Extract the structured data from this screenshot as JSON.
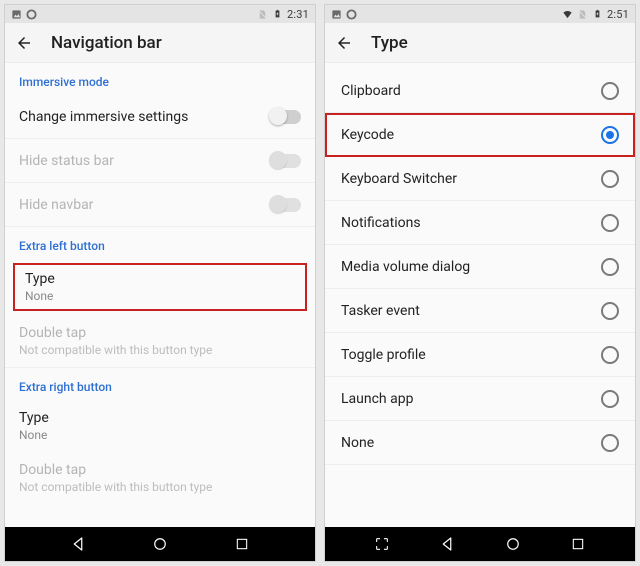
{
  "left": {
    "status": {
      "time": "2:31"
    },
    "title": "Navigation bar",
    "sections": {
      "immersive": {
        "header": "Immersive mode",
        "change": "Change immersive settings",
        "hide_status": "Hide status bar",
        "hide_nav": "Hide navbar"
      },
      "extra_left": {
        "header": "Extra left button",
        "type_label": "Type",
        "type_value": "None",
        "dtap_label": "Double tap",
        "dtap_value": "Not compatible with this button type"
      },
      "extra_right": {
        "header": "Extra right button",
        "type_label": "Type",
        "type_value": "None",
        "dtap_label": "Double tap",
        "dtap_value": "Not compatible with this button type"
      }
    }
  },
  "right": {
    "status": {
      "time": "2:51"
    },
    "title": "Type",
    "options": [
      {
        "label": "Clipboard",
        "selected": false
      },
      {
        "label": "Keycode",
        "selected": true,
        "highlight": true
      },
      {
        "label": "Keyboard Switcher",
        "selected": false
      },
      {
        "label": "Notifications",
        "selected": false
      },
      {
        "label": "Media volume dialog",
        "selected": false
      },
      {
        "label": "Tasker event",
        "selected": false
      },
      {
        "label": "Toggle profile",
        "selected": false
      },
      {
        "label": "Launch app",
        "selected": false
      },
      {
        "label": "None",
        "selected": false
      }
    ]
  }
}
